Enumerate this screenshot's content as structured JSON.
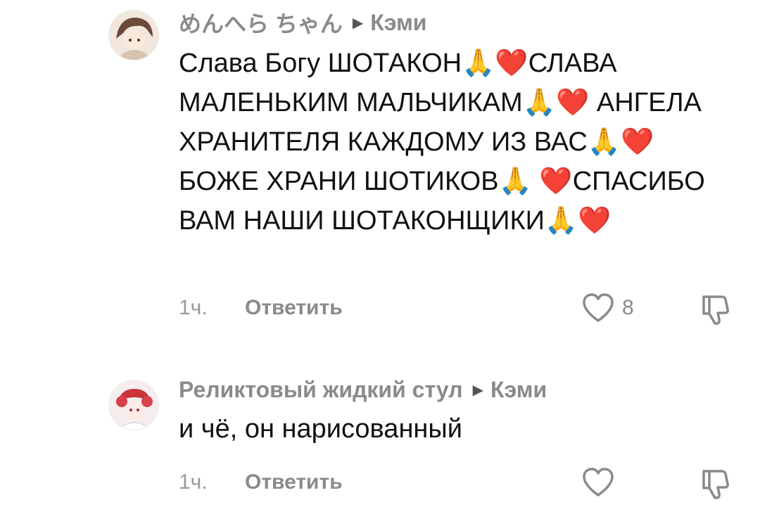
{
  "comments": [
    {
      "username": "めんへら ちゃん",
      "reply_to": "Кэми",
      "text": "Слава Богу ШОТАКОН🙏❤️СЛАВА МАЛЕНЬКИМ МАЛЬЧИКАМ🙏❤️ АНГЕЛА ХРАНИТЕЛЯ КАЖДОМУ ИЗ ВАС🙏❤️БОЖЕ ХРАНИ ШОТИКОВ🙏 ❤️СПАСИБО ВАМ НАШИ ШОТАКОНЩИКИ🙏❤️",
      "time": "1ч.",
      "reply_label": "Ответить",
      "likes": "8",
      "avatar_color": "#e9dccf"
    },
    {
      "username": "Реликтовый жидкий стул",
      "reply_to": "Кэми",
      "text": "и чё, он нарисованный",
      "time": "1ч.",
      "reply_label": "Ответить",
      "likes": "",
      "avatar_color": "#f3e6e6"
    }
  ],
  "icons": {
    "arrow": "caret-right-icon",
    "like": "heart-icon",
    "dislike": "thumbs-down-icon"
  },
  "colors": {
    "text": "#111111",
    "muted": "#8a8a8a"
  }
}
